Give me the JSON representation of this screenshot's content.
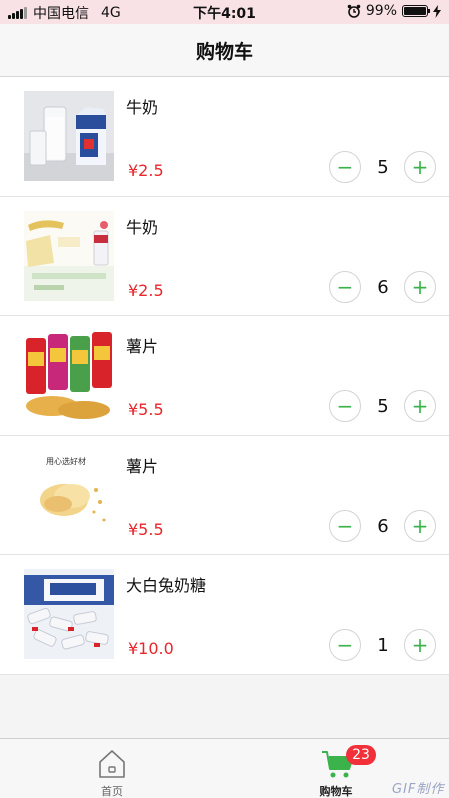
{
  "status_bar": {
    "carrier": "中国电信",
    "network": "4G",
    "time": "下午4:01",
    "battery_percent": "99%",
    "battery_level": 0.99
  },
  "nav": {
    "title": "购物车"
  },
  "items": [
    {
      "name": "牛奶",
      "price": "¥2.5",
      "quantity": "5",
      "thumb_icon": "milk-image"
    },
    {
      "name": "牛奶",
      "price": "¥2.5",
      "quantity": "6",
      "thumb_icon": "milk-ad-image"
    },
    {
      "name": "薯片",
      "price": "¥5.5",
      "quantity": "5",
      "thumb_icon": "chips-cans-image"
    },
    {
      "name": "薯片",
      "price": "¥5.5",
      "quantity": "6",
      "thumb_icon": "chips-image"
    },
    {
      "name": "大白兔奶糖",
      "price": "¥10.0",
      "quantity": "1",
      "thumb_icon": "candy-image"
    }
  ],
  "stepper": {
    "minus": "−",
    "plus": "+"
  },
  "tab_bar": {
    "home_label": "首页",
    "cart_label": "购物车",
    "cart_badge": "23",
    "accent": "#3bb34a",
    "badge_color": "#f2303a"
  },
  "thumb_text": {
    "chips_ad": "用心选好材"
  },
  "watermark": "GIF制作"
}
